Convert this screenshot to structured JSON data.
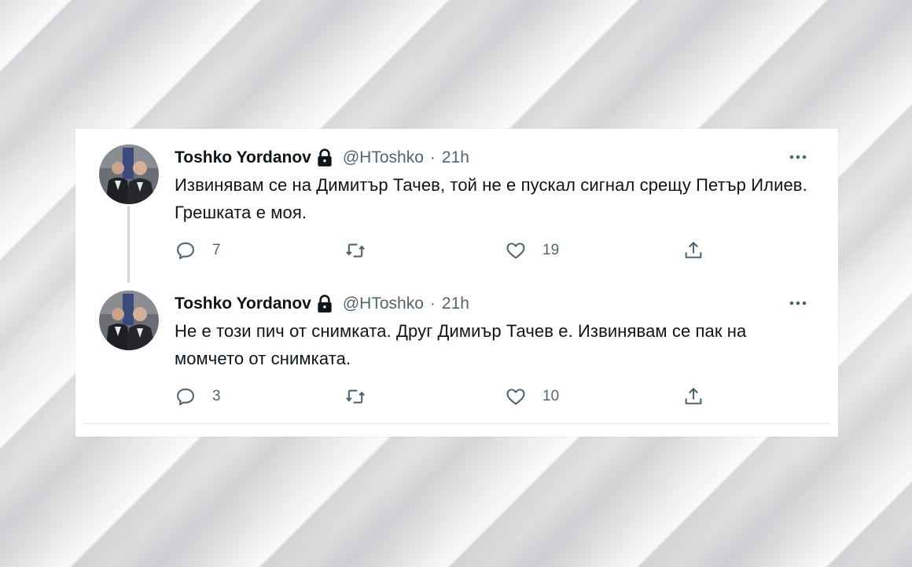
{
  "tweets": [
    {
      "name": "Toshko Yordanov",
      "handle": "@HToshko",
      "separator": "·",
      "time": "21h",
      "text": "Извинявам се на Димитър Тачев, той не е пускал сигнал срещу Петър Илиев. Грешката е моя.",
      "reply_count": "7",
      "retweet_count": "",
      "like_count": "19"
    },
    {
      "name": "Toshko Yordanov",
      "handle": "@HToshko",
      "separator": "·",
      "time": "21h",
      "text": "Не е този пич от снимката. Друг Димиър Тачев е. Извинявам се пак на момчето от снимката.",
      "reply_count": "3",
      "retweet_count": "",
      "like_count": "10"
    }
  ],
  "icons": {
    "verified_lock": "lock-icon",
    "more": "more-options-icon",
    "reply": "reply-icon",
    "retweet": "retweet-icon",
    "like": "heart-icon",
    "share": "share-icon"
  },
  "colors": {
    "text_primary": "#0f1419",
    "text_secondary": "#536471",
    "thread_line": "#cfd9de",
    "card_bg": "#ffffff"
  }
}
